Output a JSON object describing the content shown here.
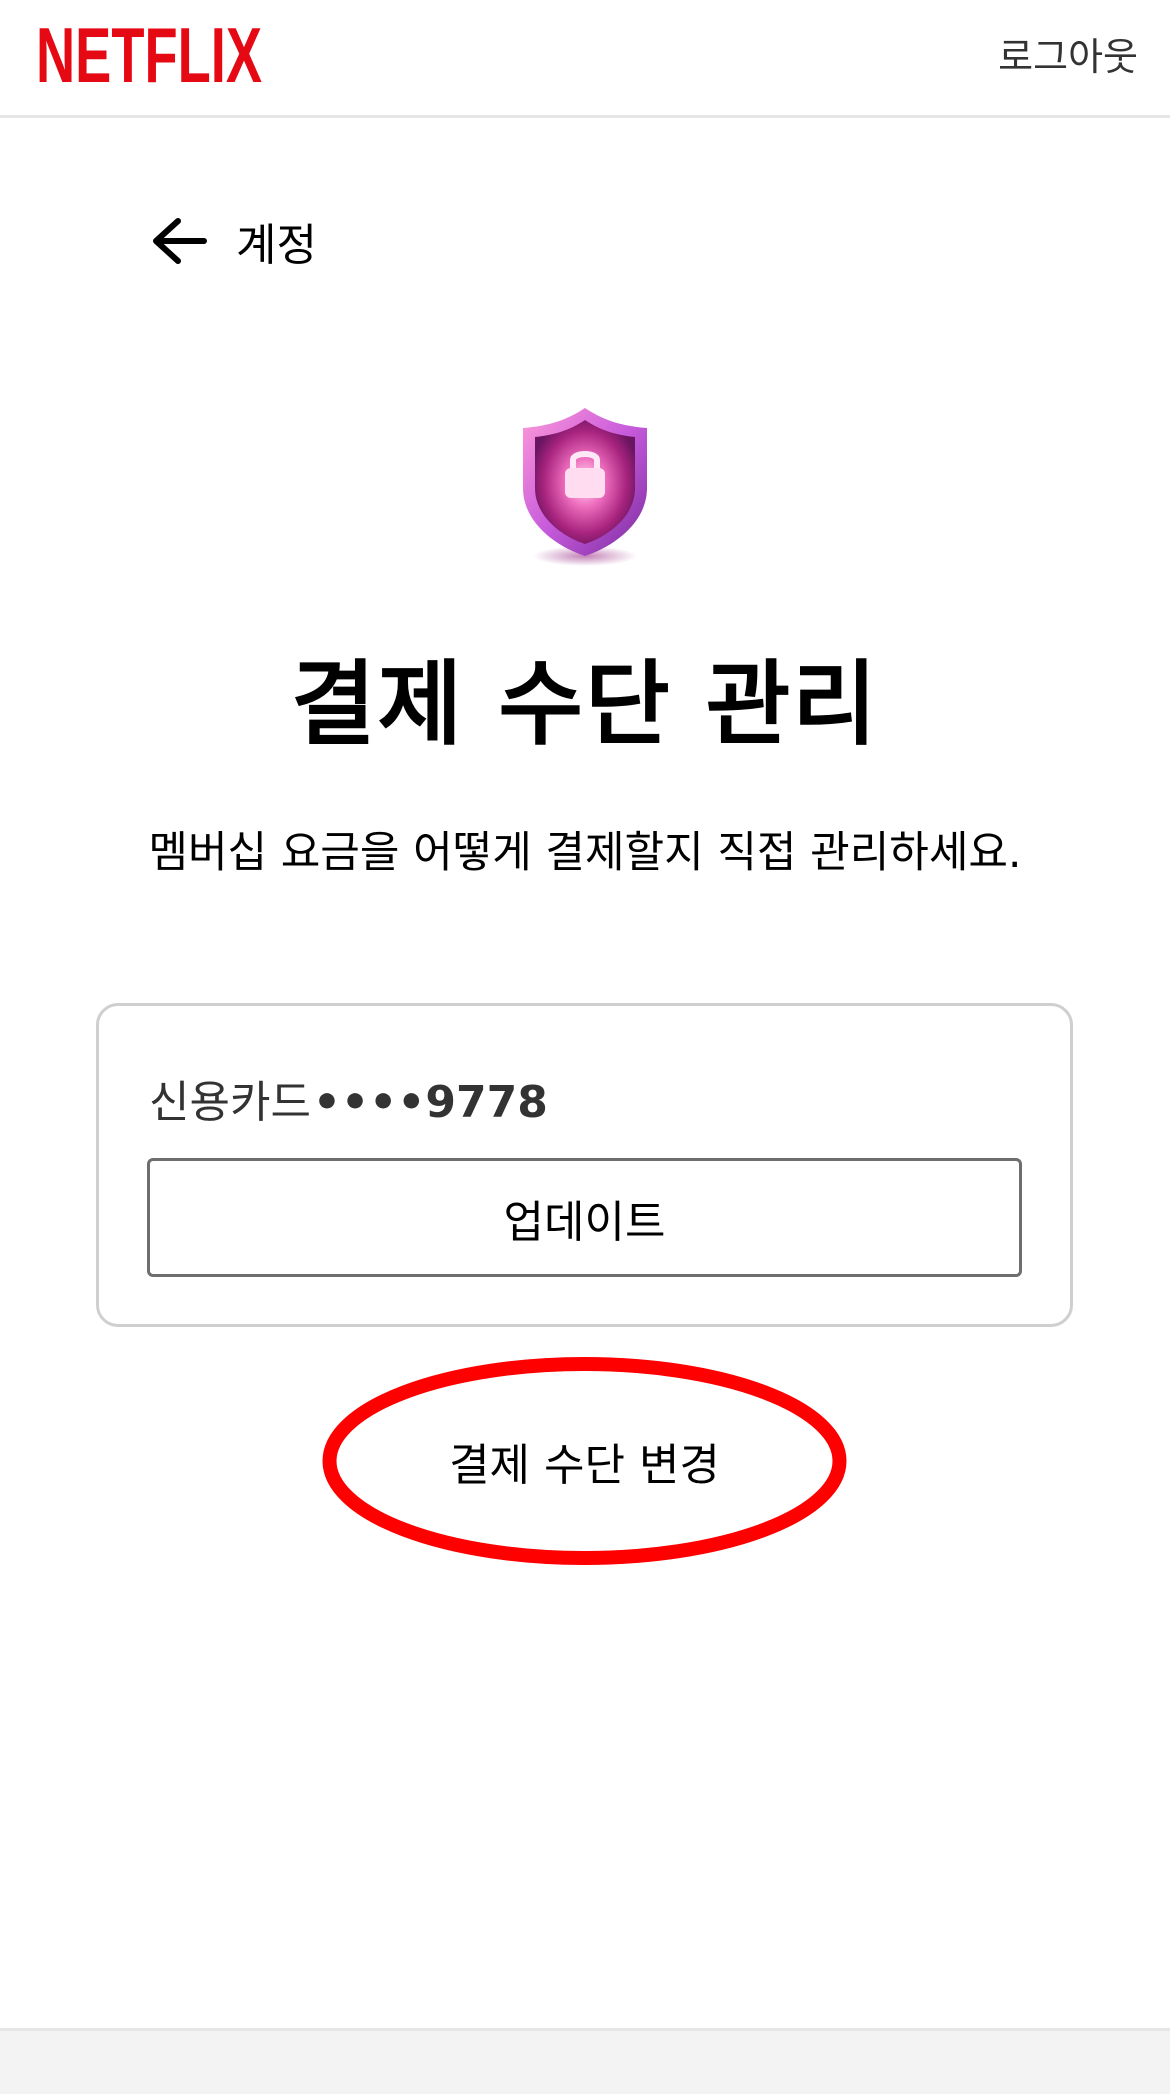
{
  "header": {
    "brand": "NETFLIX",
    "logout_label": "로그아웃"
  },
  "nav": {
    "back_label": "계정"
  },
  "main": {
    "title": "결제 수단 관리",
    "subtitle": "멤버십 요금을 어떻게 결제할지 직접 관리하세요.",
    "payment_card": {
      "type_label": "신용카드",
      "masked_number": "••••9778",
      "update_label": "업데이트"
    },
    "change_label": "결제 수단 변경"
  },
  "colors": {
    "brand_red": "#E50914",
    "highlight_red": "#FF0000",
    "shield_pink": "#D63B9A",
    "shield_purple": "#7A1C8C"
  },
  "icons": {
    "back": "arrow-left-icon",
    "shield": "shield-lock-icon"
  }
}
